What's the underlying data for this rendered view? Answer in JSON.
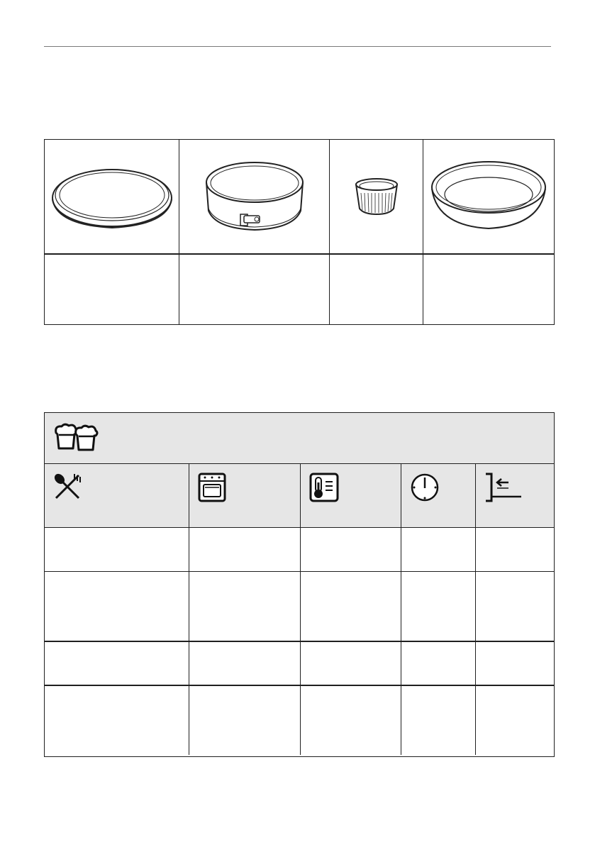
{
  "bakeware": {
    "images": [
      "flat-baking-tin-icon",
      "springform-pan-icon",
      "ramekin-icon",
      "deep-round-tin-icon"
    ],
    "labels": [
      "",
      "",
      "",
      ""
    ]
  },
  "baking_table": {
    "header_icon": "muffins-icon",
    "column_icons": [
      "food-utensils-icon",
      "oven-function-icon",
      "temperature-icon",
      "clock-icon",
      "shelf-position-icon"
    ],
    "rows": [
      [
        "",
        "",
        "",
        "",
        ""
      ],
      [
        "",
        "",
        "",
        "",
        ""
      ],
      [
        "",
        "",
        "",
        "",
        ""
      ],
      [
        "",
        "",
        "",
        "",
        ""
      ]
    ]
  }
}
